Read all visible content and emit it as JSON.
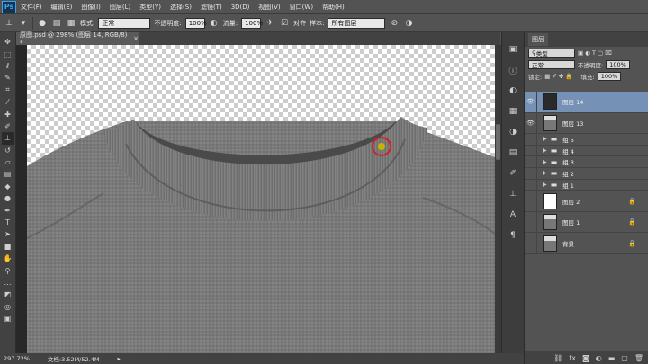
{
  "app": {
    "logo": "Ps"
  },
  "menu": [
    "文件(F)",
    "编辑(E)",
    "图像(I)",
    "图层(L)",
    "类型(Y)",
    "选择(S)",
    "滤镜(T)",
    "3D(D)",
    "视图(V)",
    "窗口(W)",
    "帮助(H)"
  ],
  "options": {
    "mode_label": "模式:",
    "mode_value": "正常",
    "opacity_label": "不透明度:",
    "opacity_value": "100%",
    "flow_label": "流量:",
    "flow_value": "100%",
    "aligned_label": "对齐",
    "sample_label": "样本:",
    "sample_value": "所有图层"
  },
  "document_tab": {
    "title": "原图.psd @ 298% (图层 14, RGB/8) *",
    "close": "×"
  },
  "status": {
    "zoom": "297.72%",
    "doc_size": "文档:3.52M/52.4M"
  },
  "layers_panel": {
    "tab_label": "图层",
    "kind_filter": "类型",
    "blend_mode": "正常",
    "opacity_label": "不透明度:",
    "opacity_value": "100%",
    "lock_label": "锁定:",
    "fill_label": "填充:",
    "fill_value": "100%",
    "layers": [
      {
        "name": "图层 14",
        "type": "layer",
        "selected": true,
        "visible": true
      },
      {
        "name": "图层 13",
        "type": "layer",
        "selected": false,
        "visible": true
      },
      {
        "name": "组 5",
        "type": "group",
        "visible": false
      },
      {
        "name": "组 4",
        "type": "group",
        "visible": false
      },
      {
        "name": "组 3",
        "type": "group",
        "visible": false
      },
      {
        "name": "组 2",
        "type": "group",
        "visible": false
      },
      {
        "name": "组 1",
        "type": "group",
        "visible": false
      },
      {
        "name": "图层 2",
        "type": "layer",
        "selected": false,
        "visible": false,
        "locked": true
      },
      {
        "name": "图层 1",
        "type": "layer",
        "selected": false,
        "visible": false,
        "locked": true
      },
      {
        "name": "背景",
        "type": "layer",
        "selected": false,
        "visible": false,
        "locked": true
      }
    ]
  },
  "colors": {
    "accent": "#31a8ff",
    "selected_layer": "#7591b5",
    "sampler_ring": "#d42020"
  }
}
